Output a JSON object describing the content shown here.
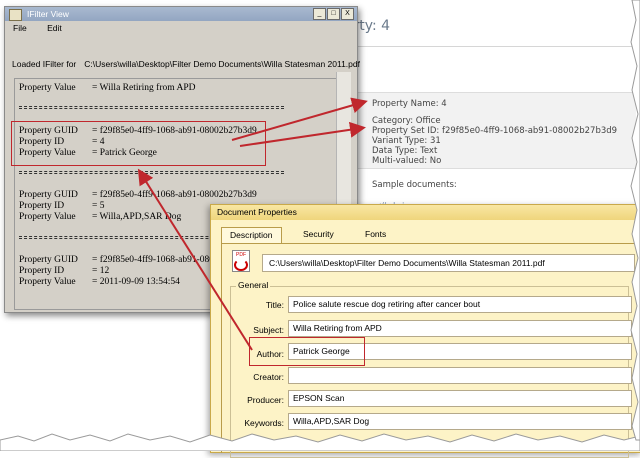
{
  "bg_page": {
    "heading": "perty: 4",
    "property_name": "Property Name:  4",
    "props": [
      "Category: Office",
      "Property Set ID: f29f85e0-4ff9-1068-ab91-08002b27b3d9",
      "Variant Type: 31",
      "Data Type: Text",
      "Multi-valued: No"
    ],
    "samples_label": "Sample documents:",
    "link_fragment": "...://...l...i..."
  },
  "ifilter": {
    "title": "IFilter View",
    "buttons": [
      "_",
      "□",
      "X"
    ],
    "menu": [
      "File",
      "Edit"
    ],
    "loaded_label": "Loaded IFilter for",
    "loaded_path": "C:\\Users\\willa\\Desktop\\Filter Demo Documents\\Willa Statesman 2011.pdf",
    "line0": {
      "key": "Property Value",
      "val": "= Willa Retiring from APD"
    },
    "block1": [
      {
        "key": "Property GUID",
        "val": "= f29f85e0-4ff9-1068-ab91-08002b27b3d9"
      },
      {
        "key": "Property ID",
        "val": "= 4"
      },
      {
        "key": "Property Value",
        "val": "= Patrick George"
      }
    ],
    "block2": [
      {
        "key": "Property GUID",
        "val": "= f29f85e0-4ff9-1068-ab91-08002b27b3d9"
      },
      {
        "key": "Property ID",
        "val": "= 5"
      },
      {
        "key": "Property Value",
        "val": "= Willa,APD,SAR Dog"
      }
    ],
    "block3": [
      {
        "key": "Property GUID",
        "val": "= f29f85e0-4ff9-1068-ab91-08002b27b3d9"
      },
      {
        "key": "Property ID",
        "val": "= 12"
      },
      {
        "key": "Property Value",
        "val": "= 2011-09-09 13:54:54"
      }
    ]
  },
  "docprops": {
    "title": "Document Properties",
    "tabs": [
      "Description",
      "Security",
      "Fonts"
    ],
    "file_path": "C:\\Users\\willa\\Desktop\\Filter Demo Documents\\Willa Statesman 2011.pdf",
    "pdf_icon_label": "PDF",
    "general_label": "General",
    "fields": {
      "title": {
        "label": "Title:",
        "value": "Police salute rescue dog retiring after cancer bout"
      },
      "subject": {
        "label": "Subject:",
        "value": "Willa Retiring from APD"
      },
      "author": {
        "label": "Author:",
        "value": "Patrick George"
      },
      "creator": {
        "label": "Creator:",
        "value": ""
      },
      "producer": {
        "label": "Producer:",
        "value": "EPSON Scan"
      },
      "keywords": {
        "label": "Keywords:",
        "value": "Willa,APD,SAR Dog"
      }
    }
  },
  "colors": {
    "highlight": "#c0272d",
    "dialog_bg": "#fdf3c7",
    "window_bg": "#d4d0c8"
  }
}
